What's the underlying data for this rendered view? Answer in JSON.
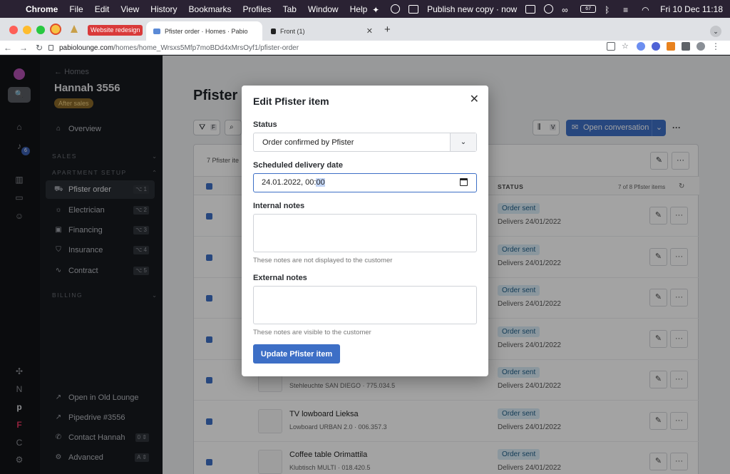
{
  "menubar": {
    "app": "Chrome",
    "items": [
      "File",
      "Edit",
      "View",
      "History",
      "Bookmarks",
      "Profiles",
      "Tab",
      "Window",
      "Help"
    ],
    "status_text": "Publish new copy · now",
    "battery": "67",
    "clock": "Fri 10 Dec  11:18"
  },
  "browser": {
    "pinned_tab_badge": "Website redesign",
    "tabs": [
      {
        "label": "Pfister order · Homes · Pabio"
      },
      {
        "label": "Front (1)"
      }
    ],
    "url_host": "pabiolounge.com",
    "url_path": "/homes/home_Wrsxs5Mfp7moBDd4xMrsOyf1/pfister-order"
  },
  "sidebar": {
    "back": "Homes",
    "title": "Hannah 3556",
    "badge": "After sales",
    "overview": "Overview",
    "section_sales": "SALES",
    "section_setup": "APARTMENT SETUP",
    "section_billing": "BILLING",
    "items": [
      {
        "label": "Pfister order",
        "key": "1"
      },
      {
        "label": "Electrician",
        "key": "2"
      },
      {
        "label": "Financing",
        "key": "3"
      },
      {
        "label": "Insurance",
        "key": "4"
      },
      {
        "label": "Contract",
        "key": "5"
      }
    ],
    "bottom": [
      {
        "label": "Open in Old Lounge"
      },
      {
        "label": "Pipedrive #3556"
      },
      {
        "label": "Contact Hannah",
        "key": "0"
      },
      {
        "label": "Advanced",
        "key": "A"
      }
    ],
    "notification_count": "6"
  },
  "main": {
    "title": "Pfister",
    "filter_key": "F",
    "view_key": "V",
    "open_conversation": "Open conversation",
    "count_text": "7 Pfister ite",
    "status_header": "STATUS",
    "pagination": "7 of 8 Pfister items",
    "rows": [
      {
        "name": "",
        "desc": "",
        "status": "Order sent",
        "delivery": "Delivers 24/01/2022"
      },
      {
        "name": "",
        "desc": "",
        "status": "Order sent",
        "delivery": "Delivers 24/01/2022"
      },
      {
        "name": "",
        "desc": "",
        "status": "Order sent",
        "delivery": "Delivers 24/01/2022"
      },
      {
        "name": "",
        "desc": "",
        "status": "Order sent",
        "delivery": "Delivers 24/01/2022"
      },
      {
        "name": "",
        "desc": "Stehleuchte SAN DIEGO · 775.034.5",
        "status": "Order sent",
        "delivery": "Delivers 24/01/2022"
      },
      {
        "name": "TV lowboard Lieksa",
        "desc": "Lowboard URBAN 2.0 · 006.357.3",
        "status": "Order sent",
        "delivery": "Delivers 24/01/2022"
      },
      {
        "name": "Coffee table Orimattila",
        "desc": "Klubtisch MULTI · 018.420.5",
        "status": "Order sent",
        "delivery": "Delivers 24/01/2022"
      }
    ]
  },
  "modal": {
    "title": "Edit Pfister item",
    "status_label": "Status",
    "status_value": "Order confirmed by Pfister",
    "date_label": "Scheduled delivery date",
    "date_value_prefix": "24.01.2022, 00:",
    "date_value_selected": "00",
    "internal_label": "Internal notes",
    "internal_help": "These notes are not displayed to the customer",
    "external_label": "External notes",
    "external_help": "These notes are visible to the customer",
    "submit": "Update Pfister item"
  },
  "colors": {
    "accent": "#3d6fc6",
    "status_pill_bg": "#d9ecf7",
    "sidebar_bg": "#171a1f"
  }
}
